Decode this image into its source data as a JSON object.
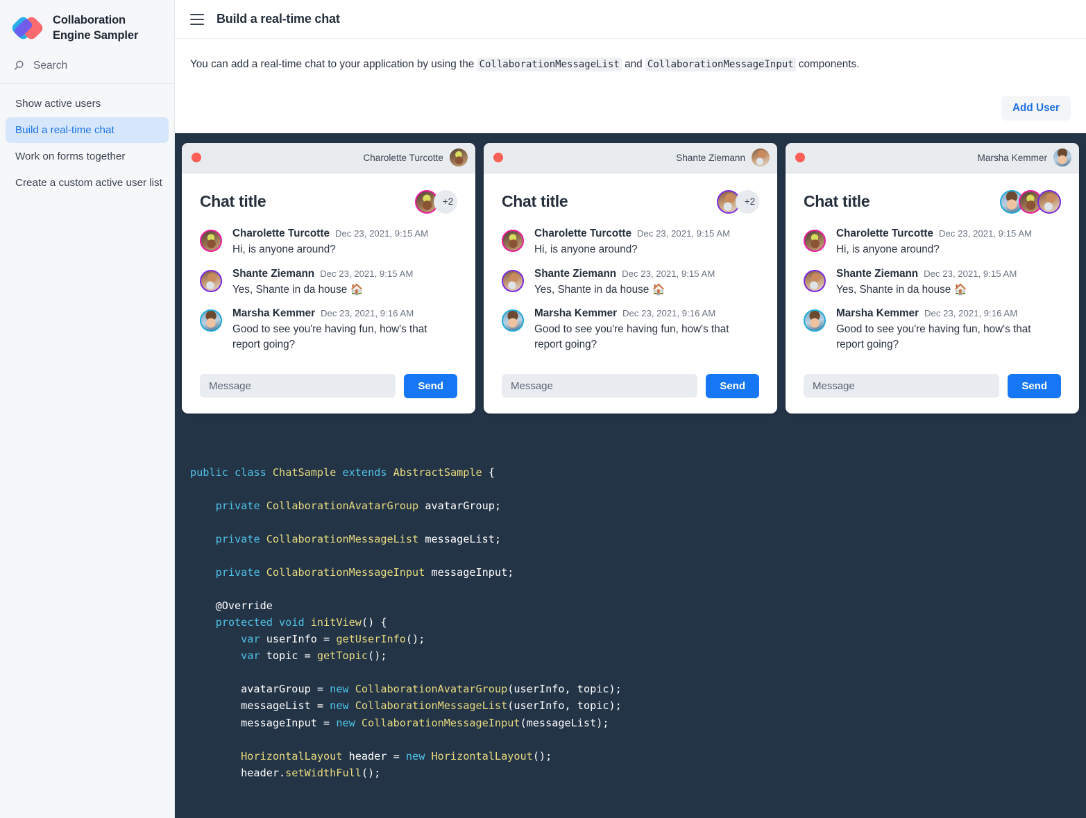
{
  "sidebar": {
    "brand_line1": "Collaboration",
    "brand_line2": "Engine Sampler",
    "search_label": "Search",
    "items": [
      {
        "label": "Show active users"
      },
      {
        "label": "Build a real-time chat"
      },
      {
        "label": "Work on forms together"
      },
      {
        "label": "Create a custom active user list"
      }
    ],
    "active_index": 1
  },
  "topbar": {
    "title": "Build a real-time chat"
  },
  "intro": {
    "part1": "You can add a real-time chat to your application by using the ",
    "code1": "CollaborationMessageList",
    "part2": " and ",
    "code2": "CollaborationMessageInput",
    "part3": " components."
  },
  "actions": {
    "add_user_label": "Add User"
  },
  "chat": {
    "title": "Chat title",
    "message_placeholder": "Message",
    "send_label": "Send",
    "overflow_badge": "+2",
    "messages": [
      {
        "author": "Charolette Turcotte",
        "time": "Dec 23, 2021, 9:15 AM",
        "text": "Hi, is anyone around?"
      },
      {
        "author": "Shante Ziemann",
        "time": "Dec 23, 2021, 9:15 AM",
        "text": "Yes, Shante in da house 🏠"
      },
      {
        "author": "Marsha Kemmer",
        "time": "Dec 23, 2021, 9:16 AM",
        "text": "Good to see you're having fun, how's that report going?"
      }
    ]
  },
  "cards": [
    {
      "user": "Charolette Turcotte",
      "avatars_shown": 1,
      "shows_overflow": true
    },
    {
      "user": "Shante Ziemann",
      "avatars_shown": 1,
      "shows_overflow": true
    },
    {
      "user": "Marsha Kemmer",
      "avatars_shown": 3,
      "shows_overflow": false
    }
  ],
  "colors": {
    "accent_blue": "#1676f3",
    "link_blue": "#1f6fe5",
    "stage_dark": "#243447",
    "window_dot_red": "#fc6058",
    "ring_pink": "#ec1ba0",
    "ring_purple": "#7a2ae0",
    "ring_cyan": "#1fa9d6"
  },
  "code": {
    "language": "java",
    "lines": [
      "public class ChatSample extends AbstractSample {",
      "",
      "    private CollaborationAvatarGroup avatarGroup;",
      "",
      "    private CollaborationMessageList messageList;",
      "",
      "    private CollaborationMessageInput messageInput;",
      "",
      "    @Override",
      "    protected void initView() {",
      "        var userInfo = getUserInfo();",
      "        var topic = getTopic();",
      "",
      "        avatarGroup = new CollaborationAvatarGroup(userInfo, topic);",
      "        messageList = new CollaborationMessageList(userInfo, topic);",
      "        messageInput = new CollaborationMessageInput(messageList);",
      "",
      "        HorizontalLayout header = new HorizontalLayout();",
      "        header.setWidthFull();"
    ]
  }
}
